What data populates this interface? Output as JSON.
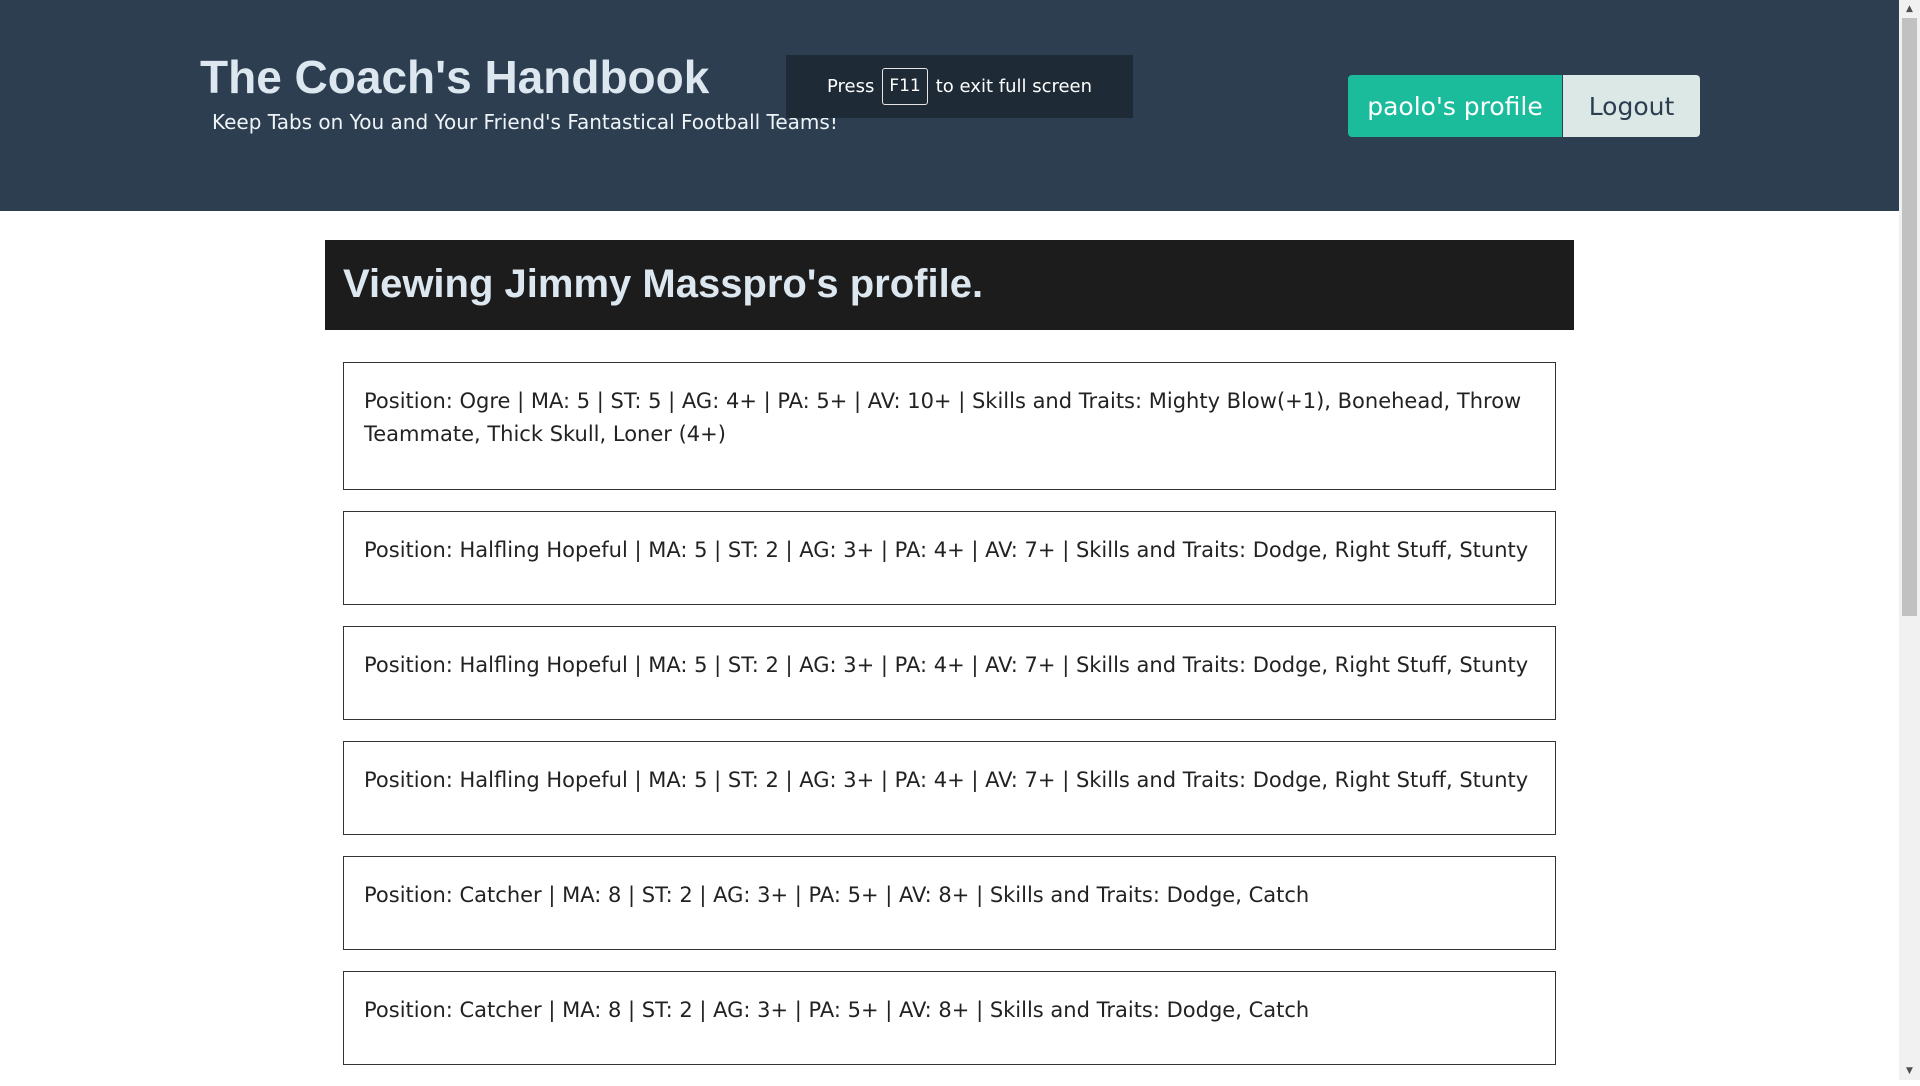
{
  "header": {
    "title": "The Coach's Handbook",
    "subtitle": "Keep Tabs on You and Your Friend's Fantastical Football Teams!",
    "profile_button": "paolo's profile",
    "logout_button": "Logout",
    "colors": {
      "header_bg": "#2c3e50",
      "accent": "#1abc9c"
    }
  },
  "fullscreen_notice": {
    "press": "Press",
    "key": "F11",
    "suffix": "to exit full screen"
  },
  "profile": {
    "heading": "Viewing Jimmy Masspro's profile."
  },
  "players": [
    {
      "text": "Position: Ogre | MA: 5 | ST: 5 | AG: 4+ | PA: 5+ | AV: 10+ | Skills and Traits: Mighty Blow(+1), Bonehead, Throw Teammate, Thick Skull, Loner (4+)"
    },
    {
      "text": "Position: Halfling Hopeful | MA: 5 | ST: 2 | AG: 3+ | PA: 4+ | AV: 7+ | Skills and Traits: Dodge, Right Stuff, Stunty"
    },
    {
      "text": "Position: Halfling Hopeful | MA: 5 | ST: 2 | AG: 3+ | PA: 4+ | AV: 7+ | Skills and Traits: Dodge, Right Stuff, Stunty"
    },
    {
      "text": "Position: Halfling Hopeful | MA: 5 | ST: 2 | AG: 3+ | PA: 4+ | AV: 7+ | Skills and Traits: Dodge, Right Stuff, Stunty"
    },
    {
      "text": "Position: Catcher | MA: 8 | ST: 2 | AG: 3+ | PA: 5+ | AV: 8+ | Skills and Traits: Dodge, Catch"
    },
    {
      "text": "Position: Catcher | MA: 8 | ST: 2 | AG: 3+ | PA: 5+ | AV: 8+ | Skills and Traits: Dodge, Catch"
    }
  ],
  "scrollbar": {
    "up_icon": "chevron-up-icon",
    "down_icon": "chevron-down-icon"
  }
}
